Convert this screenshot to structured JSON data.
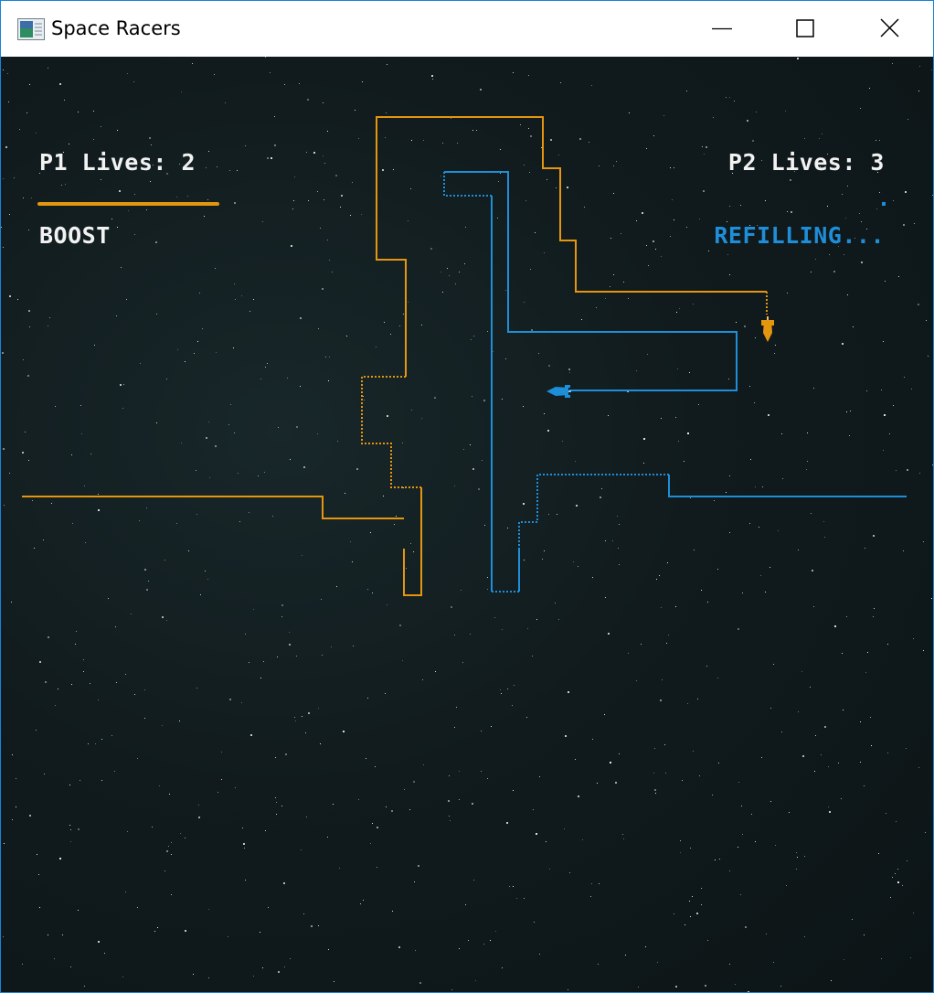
{
  "window": {
    "title": "Space Racers",
    "icon": "app-window-icon",
    "controls": [
      "minimize-icon",
      "maximize-icon",
      "close-icon"
    ]
  },
  "hud": {
    "p1_lives": "P1 Lives: 2",
    "p2_lives": "P2 Lives: 3",
    "p1_boost_status": "BOOST",
    "p2_boost_status": "REFILLING...",
    "p1_boost_level": 1.0,
    "p2_boost_level": 0.02
  },
  "colors": {
    "player1": "#e4960f",
    "player2": "#1f8ed8",
    "background": "#111b1d",
    "hud_text": "#f2f2f2"
  },
  "players": [
    {
      "id": "p1",
      "ship": "rocket-ship-icon",
      "heading": "down"
    },
    {
      "id": "p2",
      "ship": "rocket-ship-icon",
      "heading": "left"
    }
  ]
}
